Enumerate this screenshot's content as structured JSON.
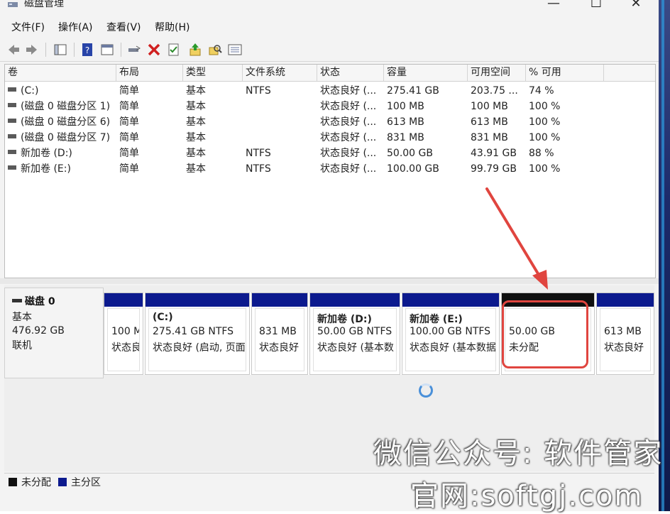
{
  "window": {
    "title": "磁盘管理"
  },
  "menu": [
    "文件(F)",
    "操作(A)",
    "查看(V)",
    "帮助(H)"
  ],
  "table": {
    "headers": [
      "卷",
      "布局",
      "类型",
      "文件系统",
      "状态",
      "容量",
      "可用空间",
      "% 可用"
    ],
    "rows": [
      [
        "(C:)",
        "简单",
        "基本",
        "NTFS",
        "状态良好 (...",
        "275.41 GB",
        "203.75 ...",
        "74 %"
      ],
      [
        "(磁盘 0 磁盘分区 1)",
        "简单",
        "基本",
        "",
        "状态良好 (...",
        "100 MB",
        "100 MB",
        "100 %"
      ],
      [
        "(磁盘 0 磁盘分区 6)",
        "简单",
        "基本",
        "",
        "状态良好 (...",
        "613 MB",
        "613 MB",
        "100 %"
      ],
      [
        "(磁盘 0 磁盘分区 7)",
        "简单",
        "基本",
        "",
        "状态良好 (...",
        "831 MB",
        "831 MB",
        "100 %"
      ],
      [
        "新加卷 (D:)",
        "简单",
        "基本",
        "NTFS",
        "状态良好 (...",
        "50.00 GB",
        "43.91 GB",
        "88 %"
      ],
      [
        "新加卷 (E:)",
        "简单",
        "基本",
        "NTFS",
        "状态良好 (...",
        "100.00 GB",
        "99.79 GB",
        "100 %"
      ]
    ]
  },
  "disk": {
    "name": "磁盘 0",
    "type": "基本",
    "size": "476.92 GB",
    "status": "联机"
  },
  "partitions": [
    {
      "name": "",
      "size": "100 M",
      "status": "状态良"
    },
    {
      "name": "(C:)",
      "size": "275.41 GB NTFS",
      "status": "状态良好 (启动, 页面"
    },
    {
      "name": "",
      "size": "831 MB",
      "status": "状态良好"
    },
    {
      "name": "新加卷 (D:)",
      "size": "50.00 GB NTFS",
      "status": "状态良好 (基本数"
    },
    {
      "name": "新加卷 (E:)",
      "size": "100.00 GB NTFS",
      "status": "状态良好 (基本数据"
    },
    {
      "name": "",
      "size": "50.00 GB",
      "status": "未分配"
    },
    {
      "name": "",
      "size": "613 MB",
      "status": "状态良好"
    }
  ],
  "legend": [
    {
      "label": "未分配",
      "color": "#101010"
    },
    {
      "label": "主分区",
      "color": "#0c1a8e"
    }
  ],
  "watermark": {
    "line1": "微信公众号: 软件管家",
    "line2": "官网:softgj.com"
  },
  "colors": {
    "primary_partition": "#0c1a8e",
    "unallocated": "#101010",
    "annotation": "#e0453f"
  }
}
